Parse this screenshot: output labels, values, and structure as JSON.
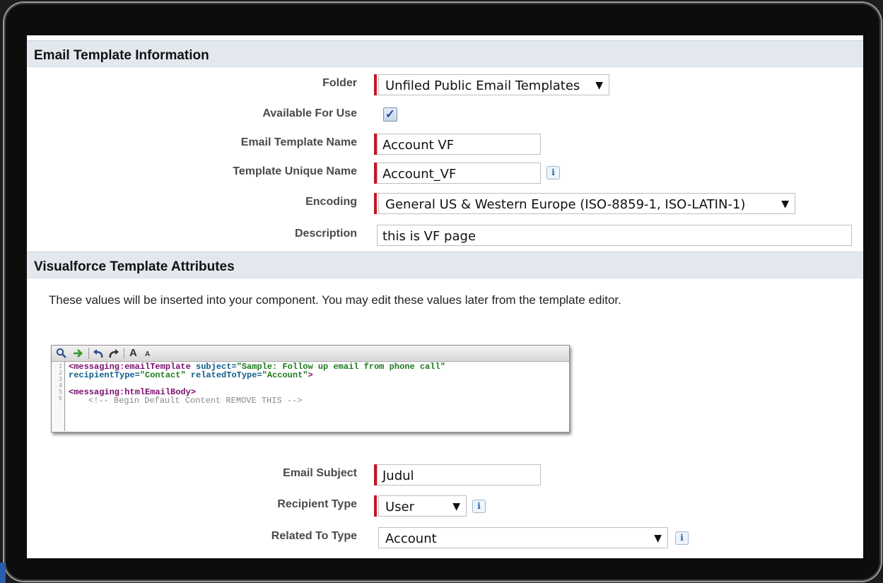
{
  "sections": {
    "info_title": "Email Template Information",
    "vf_title": "Visualforce Template Attributes"
  },
  "fields": {
    "folder_label": "Folder",
    "folder_value": "Unfiled Public Email Templates",
    "available_label": "Available For Use",
    "available_checked": true,
    "name_label": "Email Template Name",
    "name_value": "Account VF",
    "unique_label": "Template Unique Name",
    "unique_value": "Account_VF",
    "encoding_label": "Encoding",
    "encoding_value": "General US & Western Europe (ISO-8859-1, ISO-LATIN-1)",
    "description_label": "Description",
    "description_value": "this is VF page"
  },
  "vf": {
    "intro": "These values will be inserted into your component. You may edit these values later from the template editor.",
    "editor": {
      "line_numbers": [
        "1",
        "2",
        "3",
        "4",
        "5",
        "6"
      ],
      "line1_tag": "<messaging:emailTemplate",
      "line1_attr": "subject=",
      "line1_val": "\"Sample: Follow up email from phone call\"",
      "line2_attr1": "recipientType=",
      "line2_val1": "\"Contact\"",
      "line2_attr2": "relatedToType=",
      "line2_val2": "\"Account\"",
      "line2_end": ">",
      "line4_tag": "<messaging:htmlEmailBody>",
      "line5_comment": "<!-- Begin Default Content REMOVE THIS -->",
      "toolbar_font_large": "A",
      "toolbar_font_small": "A"
    },
    "subject_label": "Email Subject",
    "subject_value": "Judul",
    "recipient_label": "Recipient Type",
    "recipient_value": "User",
    "related_label": "Related To Type",
    "related_value": "Account"
  },
  "icons": {
    "info": "i",
    "dropdown": "▼",
    "check": "✓"
  },
  "colors": {
    "required_bar": "#c01726",
    "section_bg": "#e3e8ef"
  }
}
